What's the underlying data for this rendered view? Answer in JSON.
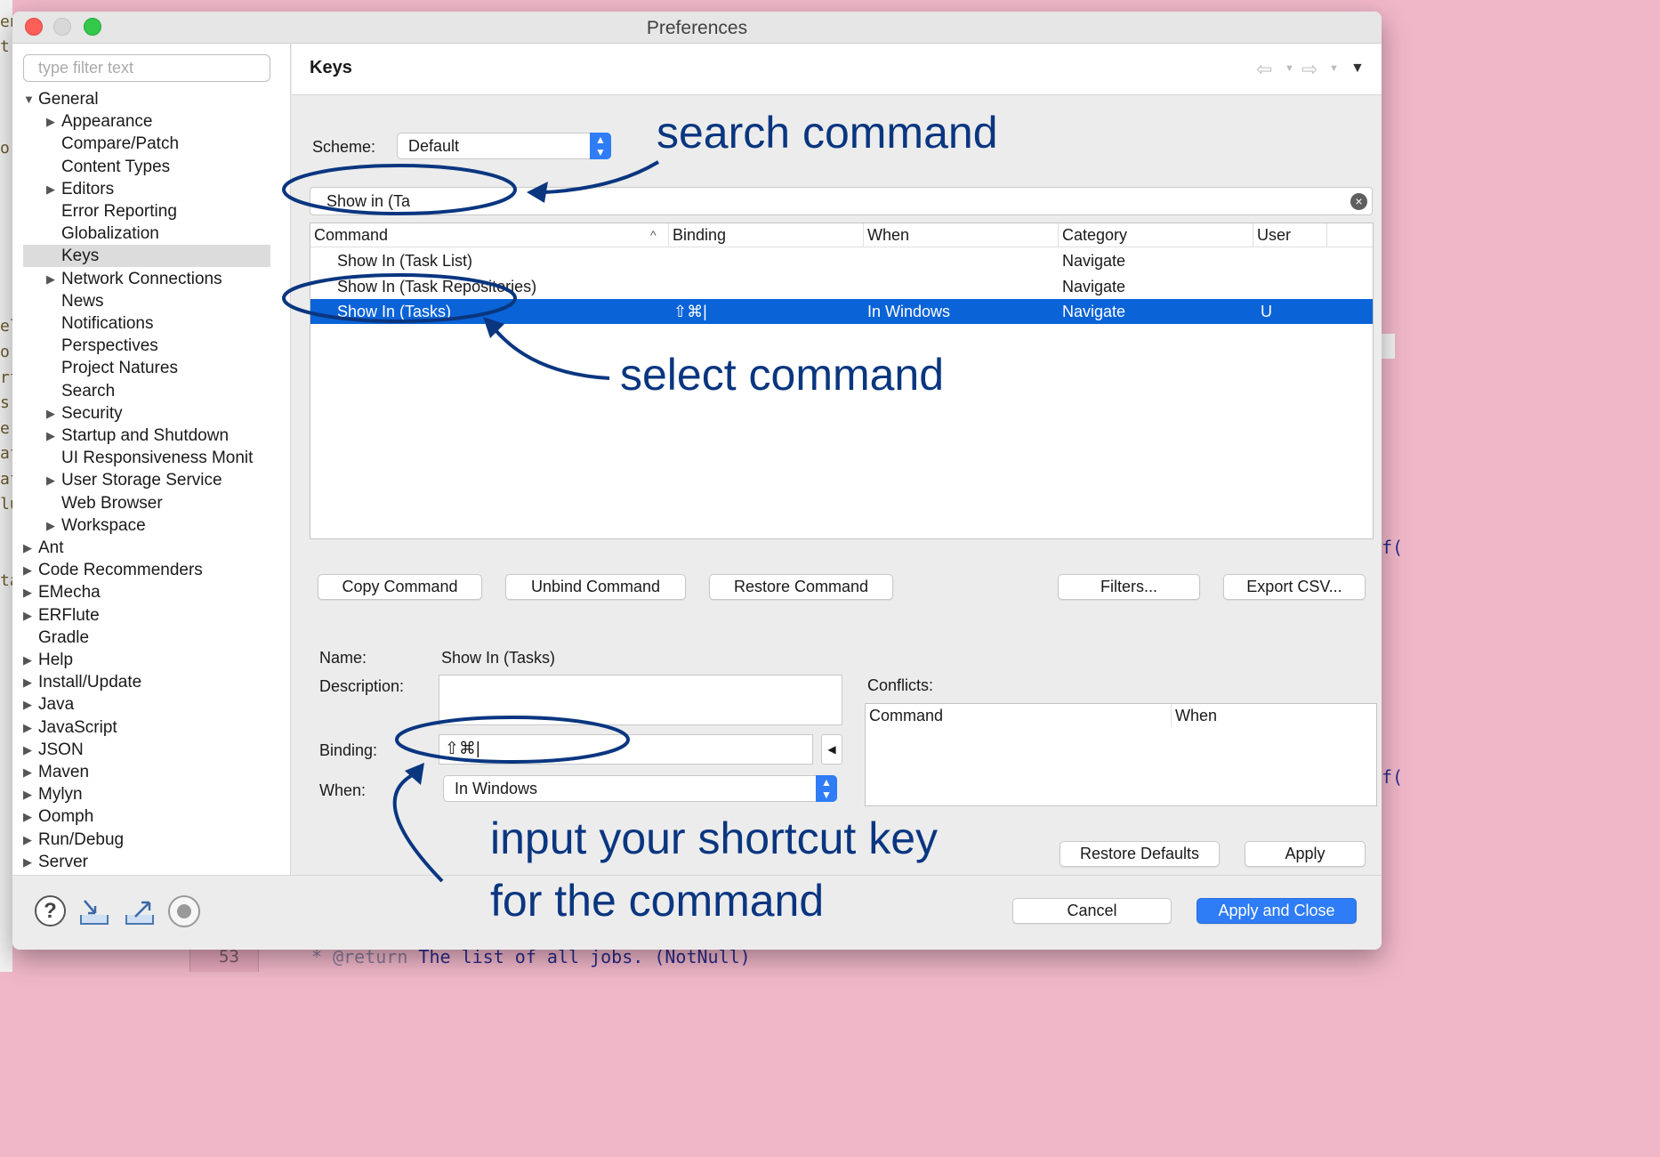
{
  "window": {
    "title": "Preferences"
  },
  "filter": {
    "placeholder": "type filter text"
  },
  "tree": [
    {
      "label": "General",
      "level": 0,
      "expanded": true
    },
    {
      "label": "Appearance",
      "level": 1,
      "expandable": true
    },
    {
      "label": "Compare/Patch",
      "level": 1
    },
    {
      "label": "Content Types",
      "level": 1
    },
    {
      "label": "Editors",
      "level": 1,
      "expandable": true
    },
    {
      "label": "Error Reporting",
      "level": 1
    },
    {
      "label": "Globalization",
      "level": 1
    },
    {
      "label": "Keys",
      "level": 1,
      "selected": true
    },
    {
      "label": "Network Connections",
      "level": 1,
      "expandable": true
    },
    {
      "label": "News",
      "level": 1
    },
    {
      "label": "Notifications",
      "level": 1
    },
    {
      "label": "Perspectives",
      "level": 1
    },
    {
      "label": "Project Natures",
      "level": 1
    },
    {
      "label": "Search",
      "level": 1
    },
    {
      "label": "Security",
      "level": 1,
      "expandable": true
    },
    {
      "label": "Startup and Shutdown",
      "level": 1,
      "expandable": true
    },
    {
      "label": "UI Responsiveness Monit",
      "level": 1
    },
    {
      "label": "User Storage Service",
      "level": 1,
      "expandable": true
    },
    {
      "label": "Web Browser",
      "level": 1
    },
    {
      "label": "Workspace",
      "level": 1,
      "expandable": true
    },
    {
      "label": "Ant",
      "level": 0,
      "expandable": true
    },
    {
      "label": "Code Recommenders",
      "level": 0,
      "expandable": true
    },
    {
      "label": "EMecha",
      "level": 0,
      "expandable": true
    },
    {
      "label": "ERFlute",
      "level": 0,
      "expandable": true
    },
    {
      "label": "Gradle",
      "level": 0
    },
    {
      "label": "Help",
      "level": 0,
      "expandable": true
    },
    {
      "label": "Install/Update",
      "level": 0,
      "expandable": true
    },
    {
      "label": "Java",
      "level": 0,
      "expandable": true
    },
    {
      "label": "JavaScript",
      "level": 0,
      "expandable": true
    },
    {
      "label": "JSON",
      "level": 0,
      "expandable": true
    },
    {
      "label": "Maven",
      "level": 0,
      "expandable": true
    },
    {
      "label": "Mylyn",
      "level": 0,
      "expandable": true
    },
    {
      "label": "Oomph",
      "level": 0,
      "expandable": true
    },
    {
      "label": "Run/Debug",
      "level": 0,
      "expandable": true
    },
    {
      "label": "Server",
      "level": 0,
      "expandable": true
    }
  ],
  "page": {
    "title": "Keys",
    "scheme_label": "Scheme:",
    "scheme_value": "Default",
    "search_value": "Show in (Ta"
  },
  "table": {
    "headers": [
      "Command",
      "Binding",
      "When",
      "Category",
      "User"
    ],
    "rows": [
      {
        "command": "Show In (Task List)",
        "binding": "",
        "when": "",
        "category": "Navigate",
        "user": "",
        "selected": false
      },
      {
        "command": "Show In (Task Repositories)",
        "binding": "",
        "when": "",
        "category": "Navigate",
        "user": "",
        "selected": false
      },
      {
        "command": "Show In (Tasks)",
        "binding": "⇧⌘|",
        "when": "In Windows",
        "category": "Navigate",
        "user": "U",
        "selected": true
      }
    ]
  },
  "buttons": {
    "copy": "Copy Command",
    "unbind": "Unbind Command",
    "restore": "Restore Command",
    "filters": "Filters...",
    "export": "Export CSV...",
    "restore_defaults": "Restore Defaults",
    "apply": "Apply",
    "cancel": "Cancel",
    "apply_close": "Apply and Close"
  },
  "details": {
    "name_label": "Name:",
    "name_value": "Show In (Tasks)",
    "description_label": "Description:",
    "binding_label": "Binding:",
    "binding_value": "⇧⌘|",
    "when_label": "When:",
    "when_value": "In Windows"
  },
  "conflicts": {
    "label": "Conflicts:",
    "headers": [
      "Command",
      "When"
    ]
  },
  "annotations": {
    "search": "search command",
    "select": "select command",
    "input_line1": "input your shortcut key",
    "input_line2": "for the command"
  },
  "background": {
    "line_number": "53",
    "code_tag": "* @return",
    "code_text": " The list of all jobs. (NotNull)",
    "left_fragments": [
      "en",
      "tr",
      "o]",
      "el",
      "o",
      "rf",
      "s",
      "e-",
      "af",
      "af",
      "lu",
      "ta"
    ],
    "right_fragment": "f("
  },
  "colors": {
    "accent": "#2e7cf6",
    "selection": "#0a63d7",
    "annotation": "#0a3680"
  }
}
